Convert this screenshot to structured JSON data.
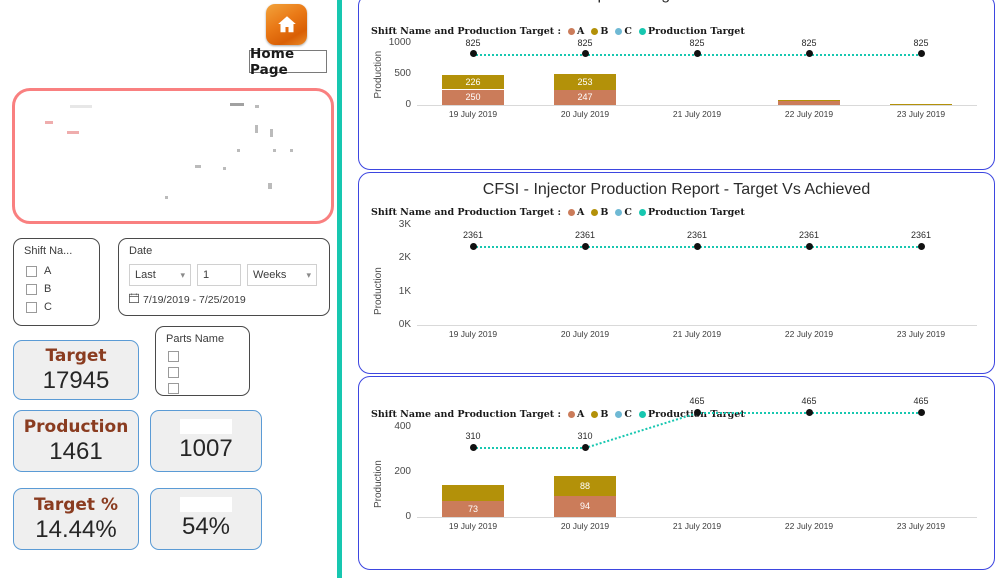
{
  "home": {
    "icon": "home-icon",
    "label": "Home Page"
  },
  "slicers": {
    "shift": {
      "title": "Shift Na...",
      "options": [
        "A",
        "B",
        "C"
      ]
    },
    "date": {
      "title": "Date",
      "relative": "Last",
      "count": "1",
      "unit": "Weeks",
      "range": "7/19/2019 - 7/25/2019",
      "calendar_icon": "calendar-icon"
    },
    "parts": {
      "title": "Parts Name",
      "options": [
        "",
        "",
        ""
      ]
    }
  },
  "cards": [
    {
      "title": "Target",
      "value": "17945",
      "blank_title": false
    },
    {
      "title": "Production",
      "value": "1461",
      "blank_title": false
    },
    {
      "title": "",
      "value": "1007",
      "blank_title": true
    },
    {
      "title": "Target %",
      "value": "14.44%",
      "blank_title": false
    },
    {
      "title": "",
      "value": "54%",
      "blank_title": true
    }
  ],
  "colors": {
    "shift_a": "#cb7c5a",
    "shift_b": "#b39109",
    "shift_c": "#6fb9d4",
    "production_target": "#17c7b0",
    "card_title": "#8a3c20",
    "card_border": "#5b9bd5",
    "panel_border": "#3d46e0",
    "divider": "#17c7b0",
    "pink_box": "#f98080"
  },
  "legend": {
    "prefix": "Shift Name and Production Target :",
    "items": [
      {
        "label": "A",
        "color": "#cb7c5a"
      },
      {
        "label": "B",
        "color": "#b39109"
      },
      {
        "label": "C",
        "color": "#6fb9d4"
      },
      {
        "label": "Production Target",
        "color": "#17c7b0"
      }
    ]
  },
  "chart_data": [
    {
      "type": "bar",
      "id": "chart-1",
      "title": "Report - Target Vs Achieved",
      "title_clipped": true,
      "xlabel": "",
      "ylabel": "Production",
      "ylim": [
        0,
        1000
      ],
      "yticks": [
        "0",
        "500",
        "1000"
      ],
      "ytick_values": [
        0,
        500,
        1000
      ],
      "categories": [
        "19 July 2019",
        "20 July 2019",
        "21 July 2019",
        "22 July 2019",
        "23 July 2019"
      ],
      "series": [
        {
          "name": "A",
          "color": "#cb7c5a",
          "values": [
            250,
            247,
            0,
            60,
            0
          ],
          "labels": [
            "250",
            "247",
            "",
            "",
            ""
          ]
        },
        {
          "name": "B",
          "color": "#b39109",
          "values": [
            226,
            253,
            0,
            26,
            10
          ],
          "labels": [
            "226",
            "253",
            "",
            "",
            ""
          ]
        }
      ],
      "target_line": {
        "name": "Production Target",
        "color": "#17c7b0",
        "values": [
          825,
          825,
          825,
          825,
          825
        ],
        "labels": [
          "825",
          "825",
          "825",
          "825",
          "825"
        ]
      }
    },
    {
      "type": "bar",
      "id": "chart-2",
      "title": "CFSI - Injector Production Report - Target Vs Achieved",
      "title_clipped": false,
      "xlabel": "",
      "ylabel": "Production",
      "ylim": [
        0,
        3000
      ],
      "yticks": [
        "0K",
        "1K",
        "2K",
        "3K"
      ],
      "ytick_values": [
        0,
        1000,
        2000,
        3000
      ],
      "categories": [
        "19 July 2019",
        "20 July 2019",
        "21 July 2019",
        "22 July 2019",
        "23 July 2019"
      ],
      "series": [
        {
          "name": "A",
          "color": "#cb7c5a",
          "values": [
            0,
            0,
            0,
            0,
            0
          ],
          "labels": [
            "",
            "",
            "",
            "",
            ""
          ]
        },
        {
          "name": "B",
          "color": "#b39109",
          "values": [
            0,
            0,
            0,
            0,
            0
          ],
          "labels": [
            "",
            "",
            "",
            "",
            ""
          ]
        }
      ],
      "target_line": {
        "name": "Production Target",
        "color": "#17c7b0",
        "values": [
          2361,
          2361,
          2361,
          2361,
          2361
        ],
        "labels": [
          "2361",
          "2361",
          "2361",
          "2361",
          "2361"
        ]
      }
    },
    {
      "type": "bar",
      "id": "chart-3",
      "title": "",
      "title_erased": true,
      "xlabel": "",
      "ylabel": "Production",
      "ylim": [
        0,
        400
      ],
      "yticks": [
        "0",
        "200",
        "400"
      ],
      "ytick_values": [
        0,
        200,
        400
      ],
      "categories": [
        "19 July 2019",
        "20 July 2019",
        "21 July 2019",
        "22 July 2019",
        "23 July 2019"
      ],
      "series": [
        {
          "name": "A",
          "color": "#cb7c5a",
          "values": [
            73,
            94,
            0,
            0,
            0
          ],
          "labels": [
            "73",
            "94",
            "",
            "",
            ""
          ]
        },
        {
          "name": "B",
          "color": "#b39109",
          "values": [
            70,
            88,
            0,
            0,
            0
          ],
          "labels": [
            "",
            "88",
            "",
            "",
            ""
          ]
        }
      ],
      "target_line": {
        "name": "Production Target",
        "color": "#17c7b0",
        "values": [
          310,
          310,
          465,
          465,
          465
        ],
        "labels": [
          "310",
          "310",
          "465",
          "465",
          "465"
        ]
      }
    }
  ]
}
